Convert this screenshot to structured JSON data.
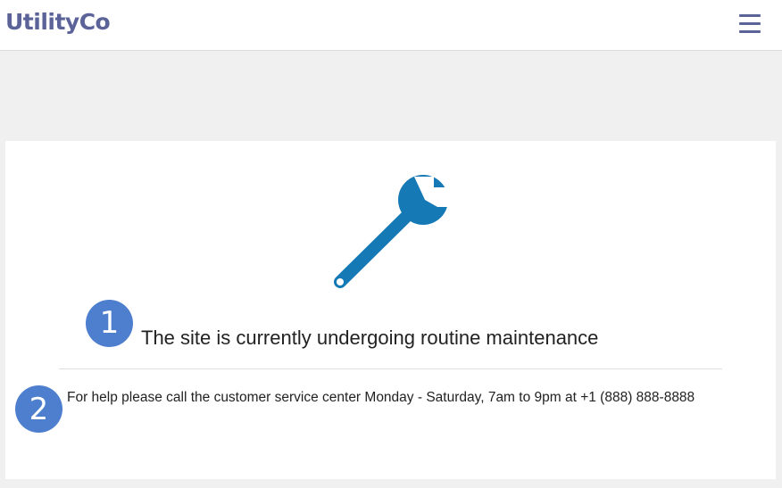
{
  "header": {
    "brand": "UtilityCo",
    "menu_icon": "hamburger-menu-icon"
  },
  "main": {
    "icon": "wrench-icon",
    "icon_color": "#1579b5",
    "headline": "The site is currently undergoing routine maintenance",
    "help_text": "For help please call the customer service center Monday - Saturday, 7am to 9pm at +1 (888) 888-8888"
  },
  "annotations": {
    "marker_1": "1",
    "marker_2": "2",
    "color": "#4e7fcf"
  }
}
